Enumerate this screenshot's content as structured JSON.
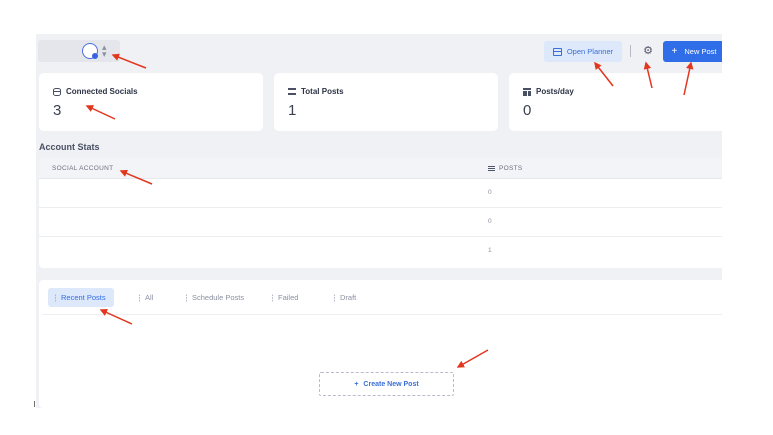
{
  "header": {
    "account_selector_icon": "avatar-icon",
    "open_planner_label": "Open Planner",
    "new_post_label": "New Post"
  },
  "stats": [
    {
      "label": "Connected Socials",
      "value": "3",
      "icon": "database-icon"
    },
    {
      "label": "Total Posts",
      "value": "1",
      "icon": "list-icon"
    },
    {
      "label": "Posts/day",
      "value": "0",
      "icon": "chart-icon"
    }
  ],
  "account_stats": {
    "title": "Account Stats",
    "columns": [
      "SOCIAL ACCOUNT",
      "POSTS"
    ],
    "rows": [
      {
        "account": "",
        "posts": "0"
      },
      {
        "account": "",
        "posts": "0"
      },
      {
        "account": "",
        "posts": "1"
      }
    ]
  },
  "posts": {
    "tabs": [
      {
        "label": "Recent Posts",
        "active": true
      },
      {
        "label": "All",
        "active": false
      },
      {
        "label": "Schedule Posts",
        "active": false
      },
      {
        "label": "Failed",
        "active": false
      },
      {
        "label": "Draft",
        "active": false
      }
    ],
    "create_label": "Create New Post"
  },
  "colors": {
    "accent": "#2f6ee8",
    "annotation_arrow": "#e2361e",
    "background": "#f0f1f5"
  }
}
